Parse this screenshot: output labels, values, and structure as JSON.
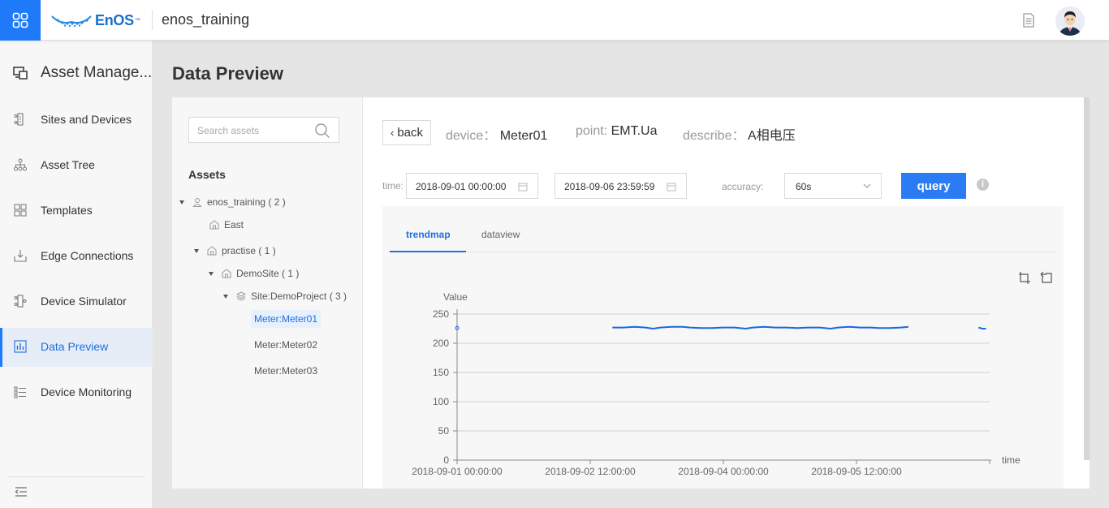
{
  "topbar": {
    "logo_text": "EnOS",
    "logo_tm": "™",
    "org_name": "enos_training"
  },
  "sidebar": {
    "header": "Asset Manage...",
    "items": [
      {
        "label": "Sites and Devices",
        "icon": "sites-devices-icon"
      },
      {
        "label": "Asset Tree",
        "icon": "asset-tree-icon"
      },
      {
        "label": "Templates",
        "icon": "templates-icon"
      },
      {
        "label": "Edge Connections",
        "icon": "edge-connections-icon"
      },
      {
        "label": "Device Simulator",
        "icon": "device-simulator-icon"
      },
      {
        "label": "Data Preview",
        "icon": "data-preview-icon",
        "active": true
      },
      {
        "label": "Device Monitoring",
        "icon": "device-monitoring-icon"
      }
    ]
  },
  "page": {
    "title": "Data Preview"
  },
  "tree": {
    "search_placeholder": "Search assets",
    "title": "Assets",
    "nodes": [
      {
        "label": "enos_training ( 2 )"
      },
      {
        "label": "East"
      },
      {
        "label": "practise ( 1 )"
      },
      {
        "label": "DemoSite ( 1 )"
      },
      {
        "label": "Site:DemoProject ( 3 )"
      },
      {
        "label": "Meter:Meter01",
        "selected": true
      },
      {
        "label": "Meter:Meter02"
      },
      {
        "label": "Meter:Meter03"
      }
    ]
  },
  "detail": {
    "back_label": "back",
    "device_key": "device：",
    "device_value": "Meter01",
    "point_key": "point:",
    "point_value": "EMT.Ua",
    "describe_key": "describe：",
    "describe_value": "A相电压",
    "time_label": "time:",
    "start_time": "2018-09-01 00:00:00",
    "end_time": "2018-09-06 23:59:59",
    "accuracy_label": "accuracy:",
    "accuracy_value": "60s",
    "query_label": "query",
    "info_icon": "i"
  },
  "tabs": {
    "trendmap": "trendmap",
    "dataview": "dataview",
    "active": "trendmap"
  },
  "colors": {
    "accent": "#1e7af8",
    "series": "#1668e3"
  },
  "chart_data": {
    "type": "line",
    "ylabel": "Value",
    "xlabel": "time",
    "ylim": [
      0,
      250
    ],
    "yticks": [
      0,
      50,
      100,
      150,
      200,
      250
    ],
    "xticks": [
      "2018-09-01 00:00:00",
      "2018-09-02 12:00:00",
      "2018-09-04 00:00:00",
      "2018-09-05 12:00:00"
    ],
    "x_range_hours": [
      0,
      144
    ],
    "grid": true,
    "series": [
      {
        "segments": [
          [
            [
              0,
              226
            ]
          ],
          [
            [
              42,
              227
            ],
            [
              45,
              227
            ],
            [
              48,
              228
            ],
            [
              51,
              227
            ],
            [
              53,
              225
            ],
            [
              55,
              227
            ],
            [
              58,
              228
            ],
            [
              61,
              228
            ],
            [
              63,
              227
            ],
            [
              66,
              226
            ],
            [
              69,
              226
            ],
            [
              72,
              227
            ],
            [
              75,
              227
            ],
            [
              78,
              225
            ],
            [
              80,
              227
            ],
            [
              83,
              228
            ],
            [
              86,
              227
            ],
            [
              89,
              227
            ],
            [
              92,
              226
            ],
            [
              95,
              227
            ],
            [
              98,
              227
            ],
            [
              101,
              225
            ],
            [
              103,
              227
            ],
            [
              106,
              228
            ],
            [
              109,
              227
            ],
            [
              112,
              227
            ],
            [
              114,
              226
            ],
            [
              117,
              226
            ],
            [
              120,
              227
            ],
            [
              122,
              228
            ]
          ],
          [
            [
              141,
              227
            ],
            [
              142,
              225
            ],
            [
              143,
              225
            ]
          ]
        ]
      }
    ]
  }
}
